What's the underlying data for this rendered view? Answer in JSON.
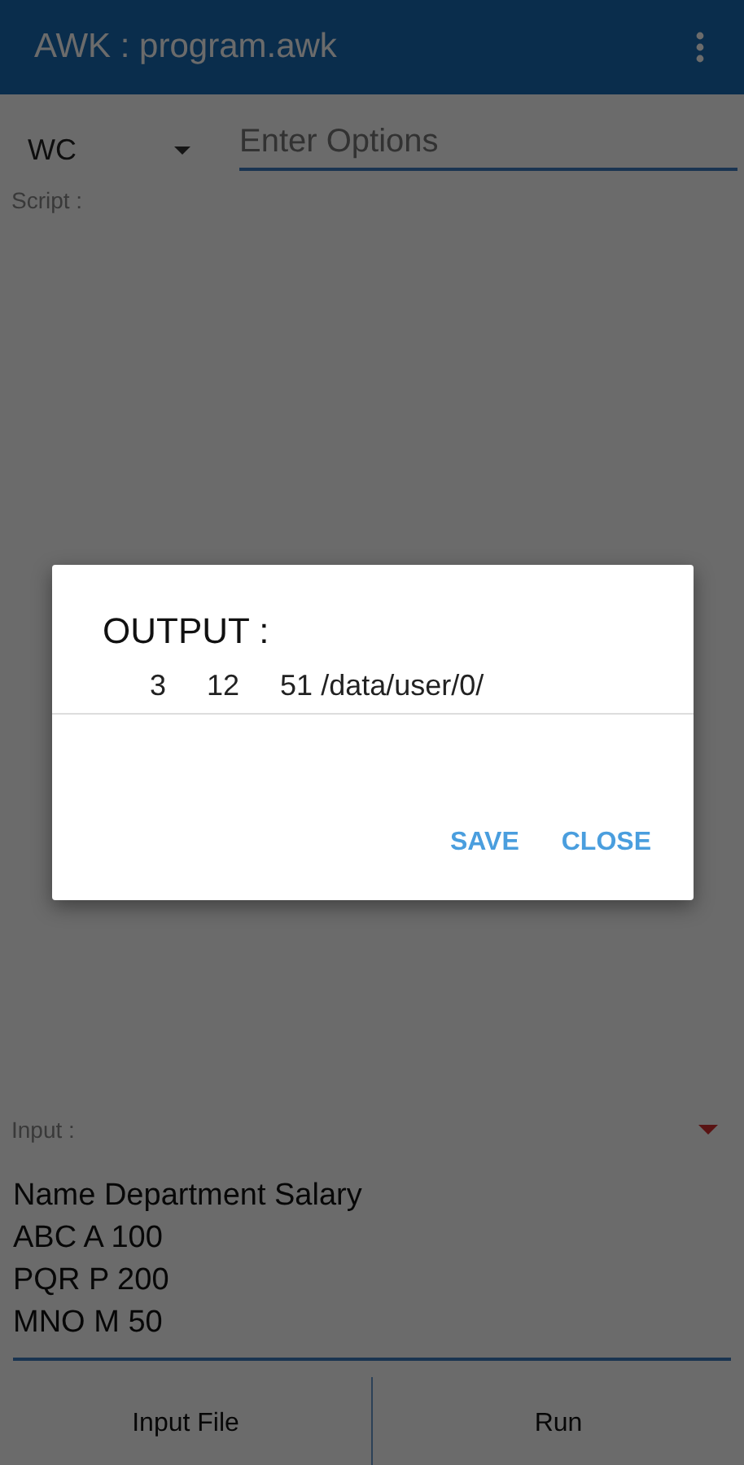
{
  "app_bar": {
    "title": "AWK : program.awk"
  },
  "command": {
    "value": "WC",
    "options_placeholder": "Enter Options"
  },
  "script": {
    "label": "Script :"
  },
  "input": {
    "label": "Input :",
    "lines": [
      "Name Department Salary",
      "ABC A 100",
      "PQR P 200",
      "MNO M 50"
    ]
  },
  "buttons": [
    "Input File",
    "Run"
  ],
  "dialog": {
    "title": "OUTPUT :",
    "output": "3     12     51 /data/user/0/",
    "actions": [
      "SAVE",
      "CLOSE"
    ]
  }
}
